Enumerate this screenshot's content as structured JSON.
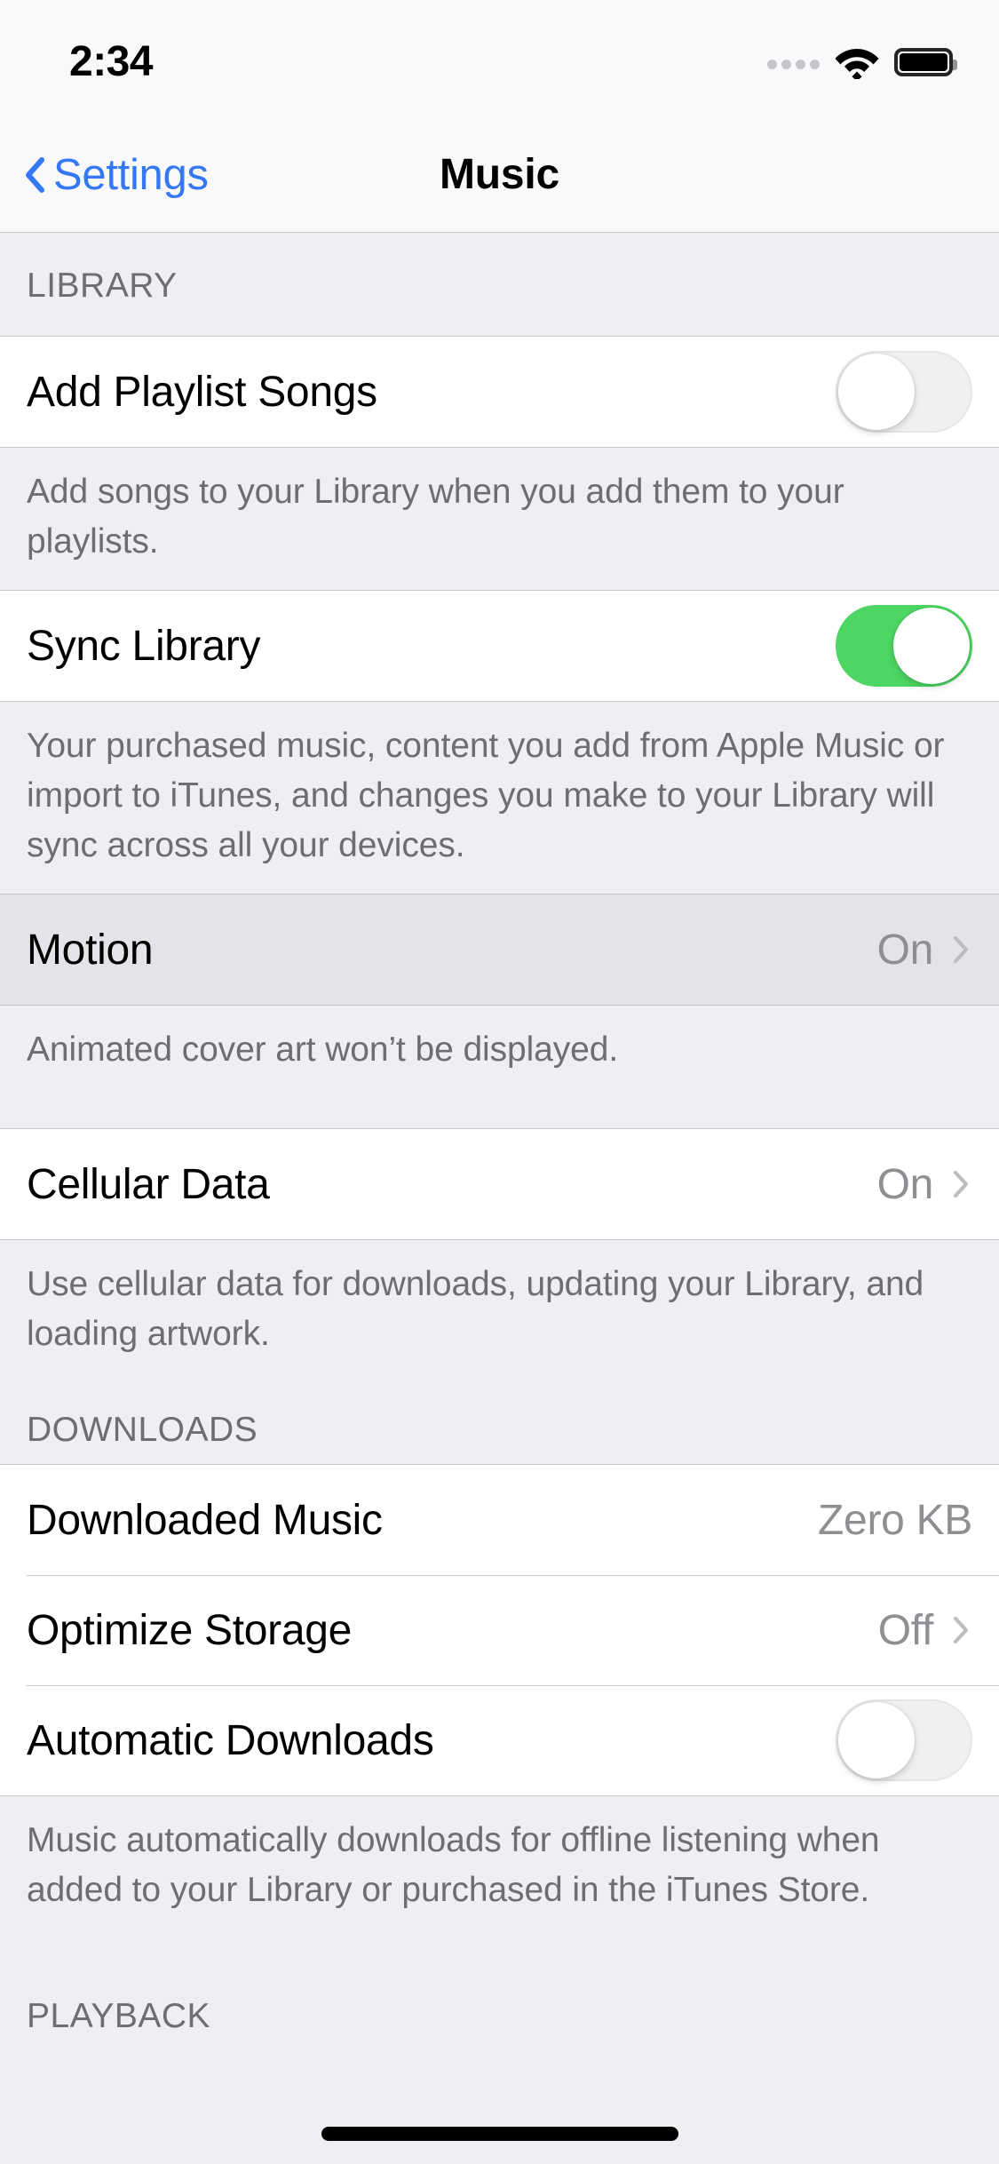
{
  "status_bar": {
    "time": "2:34",
    "wifi_icon": "wifi-icon",
    "signal_icon": "signal-dots-icon",
    "battery_icon": "battery-full-icon"
  },
  "nav": {
    "back_label": "Settings",
    "back_icon": "chevron-left-icon",
    "title": "Music"
  },
  "sections": {
    "library": {
      "header": "LIBRARY",
      "add_playlist_songs": {
        "label": "Add Playlist Songs",
        "toggle_state": "off"
      },
      "add_playlist_songs_footer": "Add songs to your Library when you add them to your playlists.",
      "sync_library": {
        "label": "Sync Library",
        "toggle_state": "on"
      },
      "sync_library_footer": "Your purchased music, content you add from Apple Music or import to iTunes, and changes you make to your Library will sync across all your devices.",
      "motion": {
        "label": "Motion",
        "value": "On",
        "chevron_icon": "chevron-right-icon",
        "pressed": true
      },
      "motion_footer": "Animated cover art won’t be displayed.",
      "cellular_data": {
        "label": "Cellular Data",
        "value": "On",
        "chevron_icon": "chevron-right-icon"
      },
      "cellular_data_footer": "Use cellular data for downloads, updating your Library, and loading artwork."
    },
    "downloads": {
      "header": "DOWNLOADS",
      "downloaded_music": {
        "label": "Downloaded Music",
        "value": "Zero KB"
      },
      "optimize_storage": {
        "label": "Optimize Storage",
        "value": "Off",
        "chevron_icon": "chevron-right-icon"
      },
      "automatic_downloads": {
        "label": "Automatic Downloads",
        "toggle_state": "off"
      },
      "automatic_downloads_footer": "Music automatically downloads for offline listening when added to your Library or purchased in the iTunes Store."
    },
    "playback": {
      "header": "PLAYBACK"
    }
  },
  "colors": {
    "accent_blue": "#3478f6",
    "toggle_green": "#4cd663",
    "secondary_text": "#6d6d72",
    "value_text": "#8e8e93",
    "group_background": "#ffffff",
    "page_background": "#efeef3",
    "separator": "#c8c7cc",
    "row_pressed": "#e3e3e8"
  }
}
